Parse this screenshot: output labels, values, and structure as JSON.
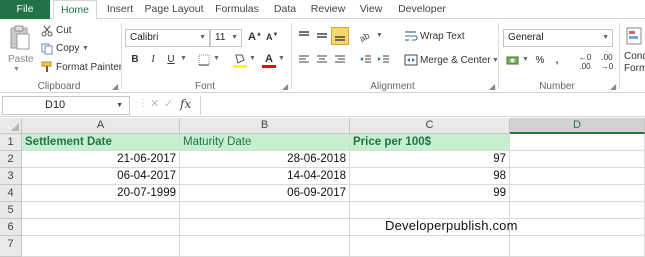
{
  "ribbon_tabs": [
    "File",
    "Home",
    "Insert",
    "Page Layout",
    "Formulas",
    "Data",
    "Review",
    "View",
    "Developer"
  ],
  "clipboard": {
    "paste_label": "Paste",
    "cut_label": "Cut",
    "copy_label": "Copy",
    "format_painter_label": "Format Painter",
    "group_label": "Clipboard"
  },
  "font": {
    "name": "Calibri",
    "size": "11",
    "grow_label": "A",
    "shrink_label": "A",
    "bold_label": "B",
    "italic_label": "I",
    "underline_label": "U",
    "fill_color": "#ffff00",
    "text_color": "#ff0000",
    "group_label": "Font"
  },
  "alignment": {
    "wrap_text_label": "Wrap Text",
    "merge_center_label": "Merge & Center",
    "group_label": "Alignment"
  },
  "number": {
    "format": "General",
    "percent_label": "%",
    "comma_label": ",",
    "inc_decimal_label": ".00",
    "dec_decimal_label": ".00",
    "group_label": "Number"
  },
  "styles": {
    "conditional_label_1": "Cond",
    "conditional_label_2": "Forma"
  },
  "formula_bar": {
    "name_box": "D10",
    "fx_label": "fx",
    "formula": ""
  },
  "sheet": {
    "columns": [
      "A",
      "B",
      "C",
      "D"
    ],
    "selected_column": "D",
    "rows": [
      "1",
      "2",
      "3",
      "4",
      "5",
      "6",
      "7"
    ],
    "headers": [
      "Settlement Date",
      "Maturity Date",
      "Price per 100$"
    ],
    "data": [
      [
        "21-06-2017",
        "28-06-2018",
        "97"
      ],
      [
        "06-04-2017",
        "14-04-2018",
        "98"
      ],
      [
        "20-07-1999",
        "06-09-2017",
        "99"
      ]
    ],
    "watermark": "Developerpublish.com"
  },
  "colors": {
    "accent": "#217346",
    "header_fill": "#c6efce"
  }
}
